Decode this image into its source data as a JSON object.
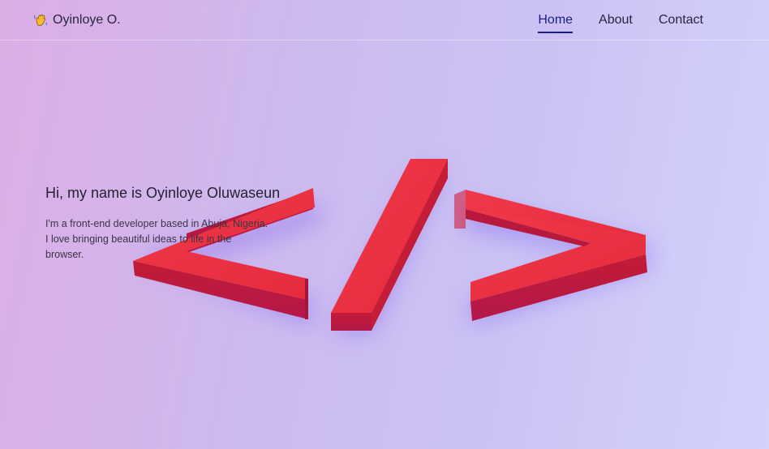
{
  "navbar": {
    "brand_name": "Oyinloye O.",
    "brand_icon": "waving-hand-icon",
    "links": [
      {
        "label": "Home",
        "active": true
      },
      {
        "label": "About",
        "active": false
      },
      {
        "label": "Contact",
        "active": false
      }
    ]
  },
  "hero": {
    "heading": "Hi, my name is Oyinloye Oluwaseun",
    "description": "I'm a front-end developer based in Abuja, Nigeria. I love bringing beautiful ideas to life in the browser.",
    "image": "code-brackets-3d-icon"
  },
  "colors": {
    "accent": "#1f1d8c",
    "symbol_red": "#e8313f",
    "text_dark": "#262233"
  }
}
